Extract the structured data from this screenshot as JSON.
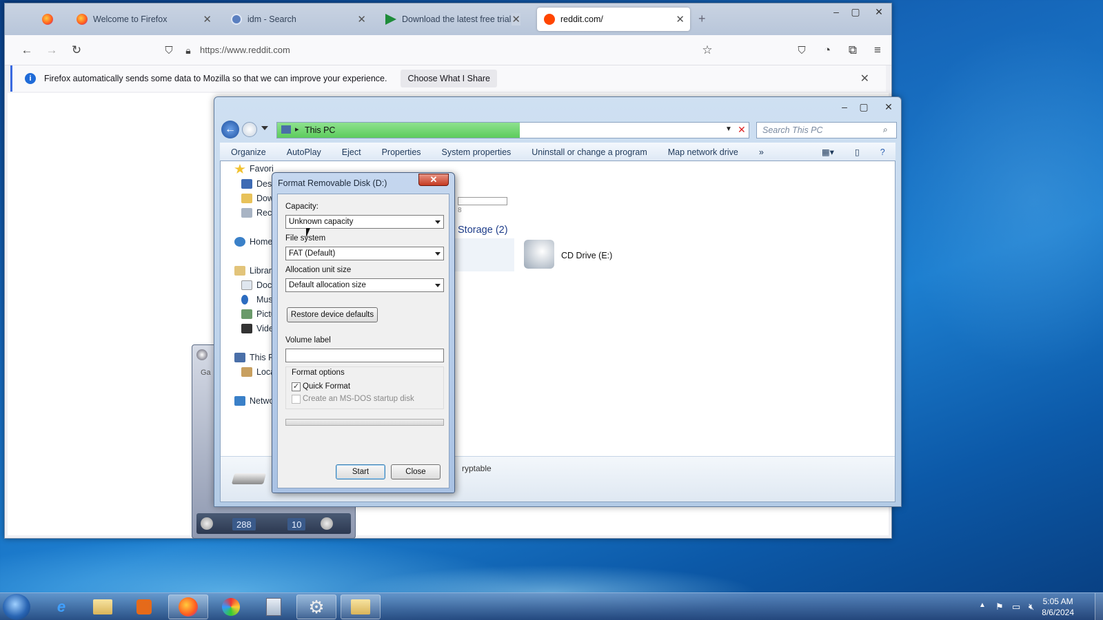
{
  "browser": {
    "tabs": [
      {
        "label": "Welcome to Firefox",
        "active": false
      },
      {
        "label": "idm - Search",
        "active": false
      },
      {
        "label": "Download the latest free trial v",
        "active": false
      },
      {
        "label": "reddit.com/",
        "active": true
      }
    ],
    "url": "https://www.reddit.com",
    "notification": {
      "message": "Firefox automatically sends some data to Mozilla so that we can improve your experience.",
      "button": "Choose What I Share"
    }
  },
  "explorer": {
    "breadcrumb": "This PC",
    "search_placeholder": "Search This PC",
    "toolbar": [
      "Organize",
      "AutoPlay",
      "Eject",
      "Properties",
      "System properties",
      "Uninstall or change a program",
      "Map network drive",
      "»"
    ],
    "nav": {
      "favorites": "Favori",
      "desktop": "Desk",
      "downloads": "Dow",
      "recent": "Rece",
      "homegroup": "Home",
      "libraries": "Librari",
      "documents": "Docu",
      "music": "Mus",
      "pictures": "Pictu",
      "videos": "Vide",
      "this_pc": "This P",
      "local": "Loca",
      "network": "Netwo"
    },
    "storage_group": "Storage (2)",
    "cd_drive": "CD Drive (E:)",
    "details_fragment": "ryptable",
    "partial_char": "8"
  },
  "dialog": {
    "title": "Format Removable Disk (D:)",
    "close_x": "✕",
    "capacity_label": "Capacity:",
    "capacity_value": "Unknown capacity",
    "filesystem_label": "File system",
    "filesystem_value": "FAT (Default)",
    "allocation_label": "Allocation unit size",
    "allocation_value": "Default allocation size",
    "restore_button": "Restore device defaults",
    "volume_label": "Volume label",
    "volume_value": "",
    "format_options": "Format options",
    "quick_format": "Quick Format",
    "quick_format_checked": true,
    "msdos": "Create an MS-DOS startup disk",
    "msdos_checked": false,
    "start_button": "Start",
    "close_button": "Close"
  },
  "gadget": {
    "tab_fragment": "Ga",
    "value1": "288",
    "value2": "10"
  },
  "taskbar": {
    "time": "5:05 AM",
    "date": "8/6/2024"
  }
}
